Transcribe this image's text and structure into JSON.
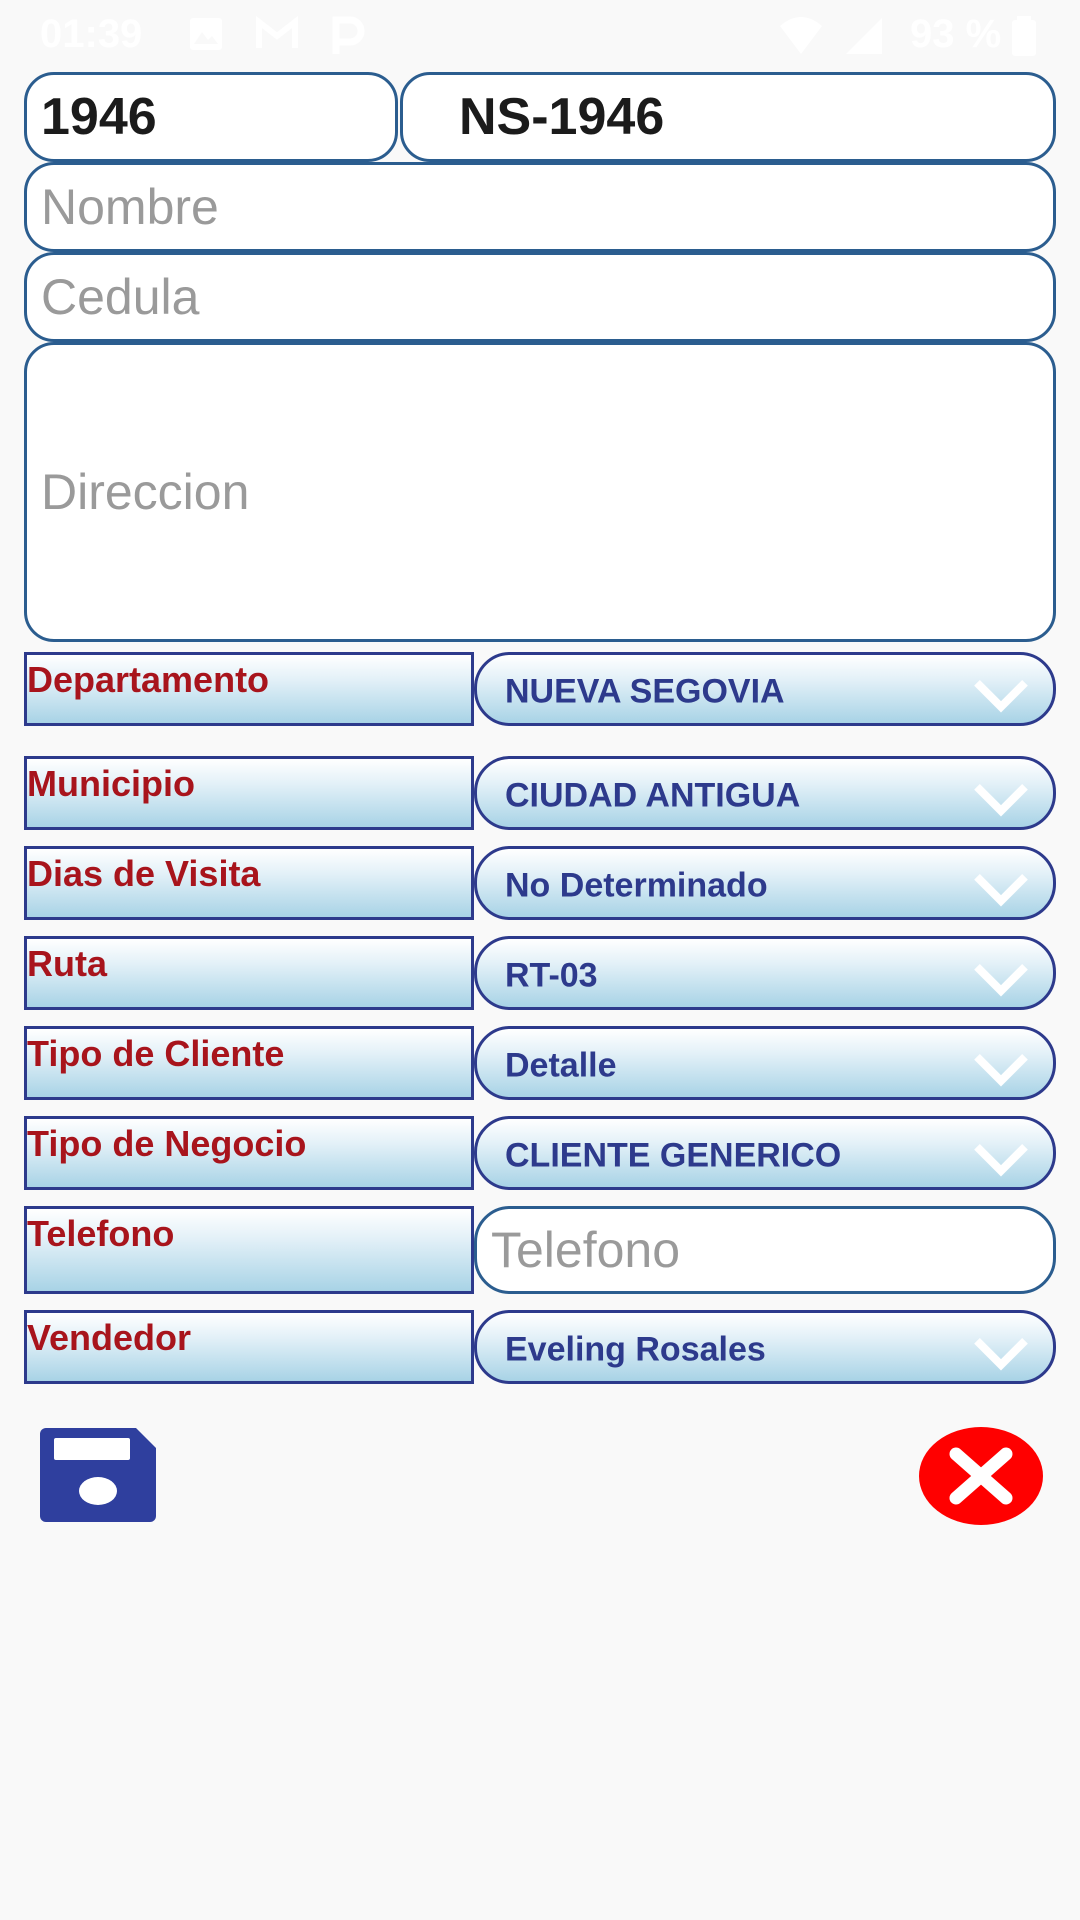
{
  "status_bar": {
    "time": "01:39",
    "battery_text": "93 %",
    "icons": [
      "image-icon",
      "gmail-icon",
      "parking-icon",
      "wifi-icon",
      "signal-icon",
      "battery-icon"
    ]
  },
  "form": {
    "code": "1946",
    "client_id": "NS-1946",
    "nombre_placeholder": "Nombre",
    "cedula_placeholder": "Cedula",
    "direccion_placeholder": "Direccion",
    "telefono_placeholder": "Telefono"
  },
  "fields": {
    "departamento": {
      "label": "Departamento",
      "value": "NUEVA SEGOVIA"
    },
    "municipio": {
      "label": "Municipio",
      "value": "CIUDAD ANTIGUA"
    },
    "dias_visita": {
      "label": "Dias de Visita",
      "value": "No Determinado"
    },
    "ruta": {
      "label": "Ruta",
      "value": "RT-03"
    },
    "tipo_cliente": {
      "label": "Tipo de Cliente",
      "value": "Detalle"
    },
    "tipo_negocio": {
      "label": "Tipo de Negocio",
      "value": "CLIENTE GENERICO"
    },
    "telefono": {
      "label": "Telefono"
    },
    "vendedor": {
      "label": "Vendedor",
      "value": "Eveling Rosales"
    }
  },
  "actions": {
    "save_icon": "floppy-disk-icon",
    "cancel_icon": "close-circle-icon"
  },
  "colors": {
    "label_text": "#a8141c",
    "value_text": "#2d3a8c",
    "border": "#2d3a8c",
    "cancel_red": "#ff0000",
    "save_blue": "#2f3f9e"
  }
}
